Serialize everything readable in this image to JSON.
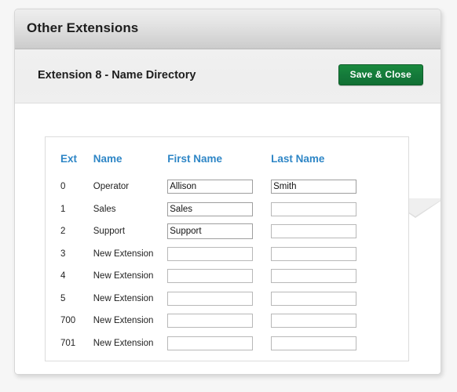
{
  "window": {
    "title": "Other Extensions"
  },
  "subheader": {
    "title": "Extension 8 - Name Directory",
    "save_label": "Save & Close"
  },
  "colors": {
    "accent_blue": "#2e86c6",
    "save_button_green": "#14793a",
    "titlebar_gradient_top": "#eeeeee",
    "titlebar_gradient_bottom": "#c7c7c7",
    "panel_background": "#ffffff",
    "page_background": "#f6f6f6"
  },
  "table": {
    "headers": {
      "ext": "Ext",
      "name": "Name",
      "first_name": "First Name",
      "last_name": "Last Name"
    },
    "rows": [
      {
        "ext": "0",
        "name": "Operator",
        "first_name": "Allison",
        "last_name": "Smith"
      },
      {
        "ext": "1",
        "name": "Sales",
        "first_name": "Sales",
        "last_name": ""
      },
      {
        "ext": "2",
        "name": "Support",
        "first_name": "Support",
        "last_name": ""
      },
      {
        "ext": "3",
        "name": "New Extension",
        "first_name": "",
        "last_name": ""
      },
      {
        "ext": "4",
        "name": "New Extension",
        "first_name": "",
        "last_name": ""
      },
      {
        "ext": "5",
        "name": "New Extension",
        "first_name": "",
        "last_name": ""
      },
      {
        "ext": "700",
        "name": "New Extension",
        "first_name": "",
        "last_name": ""
      },
      {
        "ext": "701",
        "name": "New Extension",
        "first_name": "",
        "last_name": ""
      }
    ]
  }
}
